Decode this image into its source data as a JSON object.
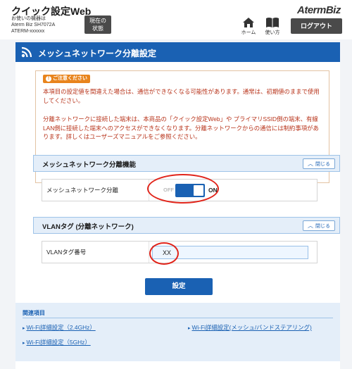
{
  "header": {
    "app_title": "クイック設定Web",
    "device_info": [
      "お使いの機器は",
      "Aterm Biz SH7072A",
      "ATERM-xxxxxx"
    ],
    "status_button": [
      "現在の",
      "状態"
    ],
    "brand": "AtermBiz",
    "home_label": "ホーム",
    "manual_label": "使い方",
    "logout_label": "ログアウト"
  },
  "page": {
    "title": "メッシュネットワーク分離設定"
  },
  "notice": {
    "badge": "ご注意ください",
    "paragraph1": "本項目の設定値を間違えた場合は、通信ができなくなる可能性があります。通常は、初期値のままで使用してください。",
    "paragraph2": "分離ネットワークに接続した端末は、本商品の「クイック設定Web」や プライマリSSID側の端末、有線LAN側に接続した端末へのアクセスができなくなります。分離ネットワークからの通信には制約事項があります。詳しくはユーザーズマニュアルをご参照ください。"
  },
  "sections": {
    "mesh": {
      "title": "メッシュネットワーク分離機能",
      "close_label": "閉じる",
      "row_label": "メッシュネットワーク分離",
      "toggle_off": "OFF",
      "toggle_on": "ON",
      "toggle_state": "on"
    },
    "vlan": {
      "title": "VLANタグ (分離ネットワーク)",
      "close_label": "閉じる",
      "row_label": "VLANタグ番号",
      "value": "XX"
    }
  },
  "apply_label": "設定",
  "related": {
    "title": "関連項目",
    "links": [
      "Wi-Fi詳細設定（2.4GHz）",
      "Wi-Fi詳細設定(メッシュ/バンドステアリング)",
      "Wi-Fi詳細設定（5GHz）"
    ]
  },
  "colors": {
    "primary": "#1a61b3",
    "warning_text": "#b8341b",
    "highlight": "#e1251b",
    "badge": "#e8841d"
  }
}
